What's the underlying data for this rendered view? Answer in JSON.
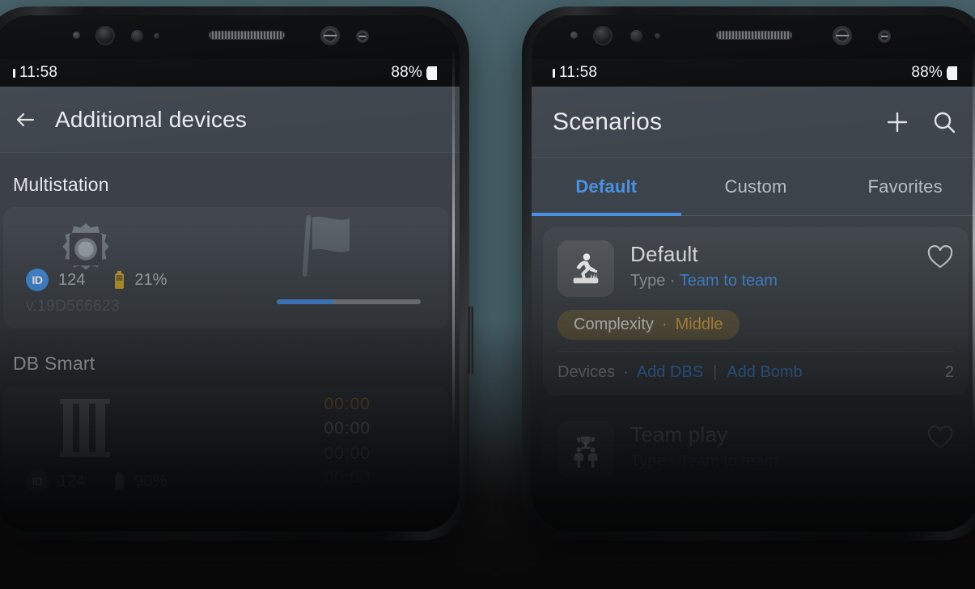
{
  "theme": {
    "accent_blue": "#4a90e2",
    "amber": "#e0a84d",
    "app_bg": "#3b4147",
    "appbar_bg": "#3f454c",
    "page_bg": "#4a656e",
    "text_primary": "#e7eaec",
    "text_secondary": "#9aa2a9"
  },
  "status_bar": {
    "time": "11:58",
    "battery_percent": "88%",
    "signal_icon": "signal-icon",
    "battery_icon": "battery-icon"
  },
  "left_phone": {
    "appbar": {
      "back_icon": "back-arrow-icon",
      "title": "Additiomal devices"
    },
    "sections": [
      {
        "label": "Multistation",
        "card": {
          "device_icon": "multistation-icon",
          "flag_icon": "flag-icon",
          "id_badge": "ID",
          "id_value": "124",
          "battery_icon": "battery-icon",
          "battery_value": "21%",
          "version": "v.19D566623",
          "progress_percent": 40
        }
      },
      {
        "label": "DB Smart",
        "card": {
          "device_icon": "db-smart-icon",
          "id_badge": "ID",
          "id_value": "124",
          "battery_icon": "battery-icon",
          "battery_value": "90%",
          "timers": [
            "00:00",
            "00:00",
            "00:00",
            "00:00"
          ]
        }
      }
    ]
  },
  "right_phone": {
    "appbar": {
      "title": "Scenarios",
      "add_icon": "plus-icon",
      "search_icon": "search-icon"
    },
    "tabs": [
      {
        "label": "Default",
        "active": true
      },
      {
        "label": "Custom",
        "active": false
      },
      {
        "label": "Favorites",
        "active": false
      }
    ],
    "scenarios": [
      {
        "thumb_icon": "runner-icon",
        "title": "Default",
        "type_label": "Type",
        "type_separator": "·",
        "type_value": "Team to team",
        "favorite_icon": "heart-outline-icon",
        "badge": {
          "label": "Complexity",
          "separator": "·",
          "value": "Middle"
        },
        "footer": {
          "label": "Devices",
          "separator": "·",
          "links": [
            "Add DBS",
            "Add Bomb"
          ],
          "link_divider": "|",
          "count": "2"
        }
      },
      {
        "thumb_icon": "team-icon",
        "title": "Team play",
        "type_label": "Type",
        "type_separator": "·",
        "type_value": "Team to team",
        "favorite_icon": "heart-outline-icon"
      }
    ]
  }
}
